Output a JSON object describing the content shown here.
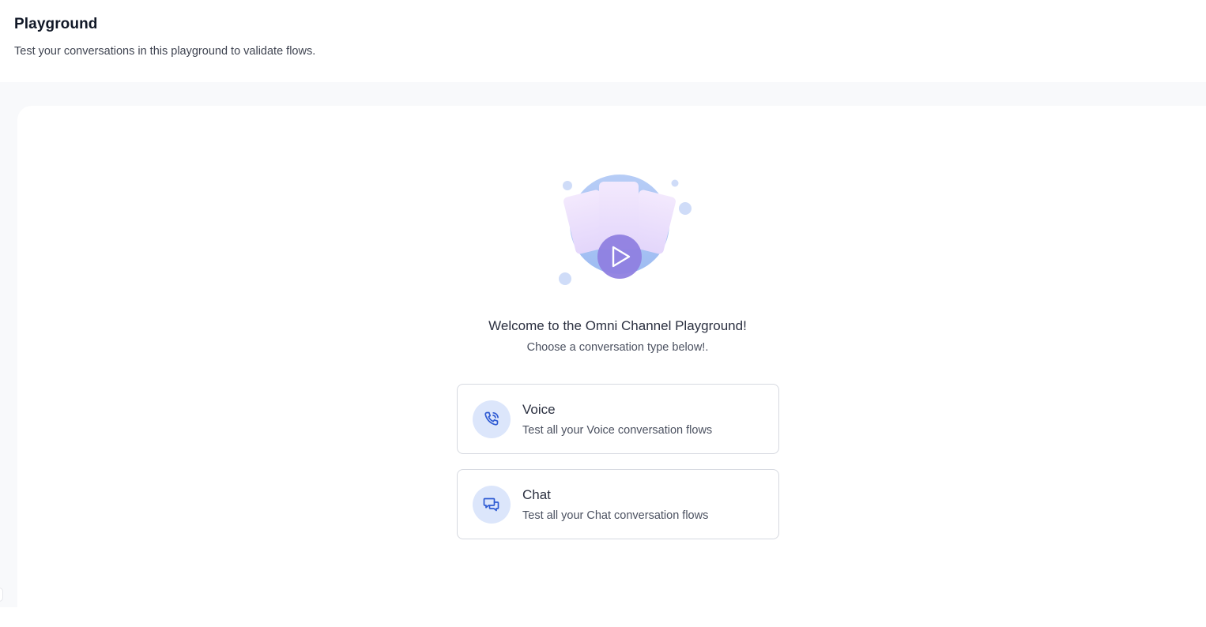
{
  "header": {
    "title": "Playground",
    "subtitle": "Test your conversations in this playground to validate flows."
  },
  "welcome": {
    "title": "Welcome to the Omni Channel Playground!",
    "subtitle": "Choose a conversation type below!.",
    "illustration_icon": "play-icon"
  },
  "options": [
    {
      "title": "Voice",
      "description": "Test all your Voice conversation flows",
      "icon": "phone-icon"
    },
    {
      "title": "Chat",
      "description": "Test all your Chat conversation flows",
      "icon": "chat-bubbles-icon"
    }
  ],
  "colors": {
    "accent": "#2f5bd3",
    "icon_bg": "#dce6fb",
    "illustration_blue": "#a9c4f5",
    "illustration_purple": "#8f7fe0",
    "content_bg": "#f8f9fb"
  }
}
